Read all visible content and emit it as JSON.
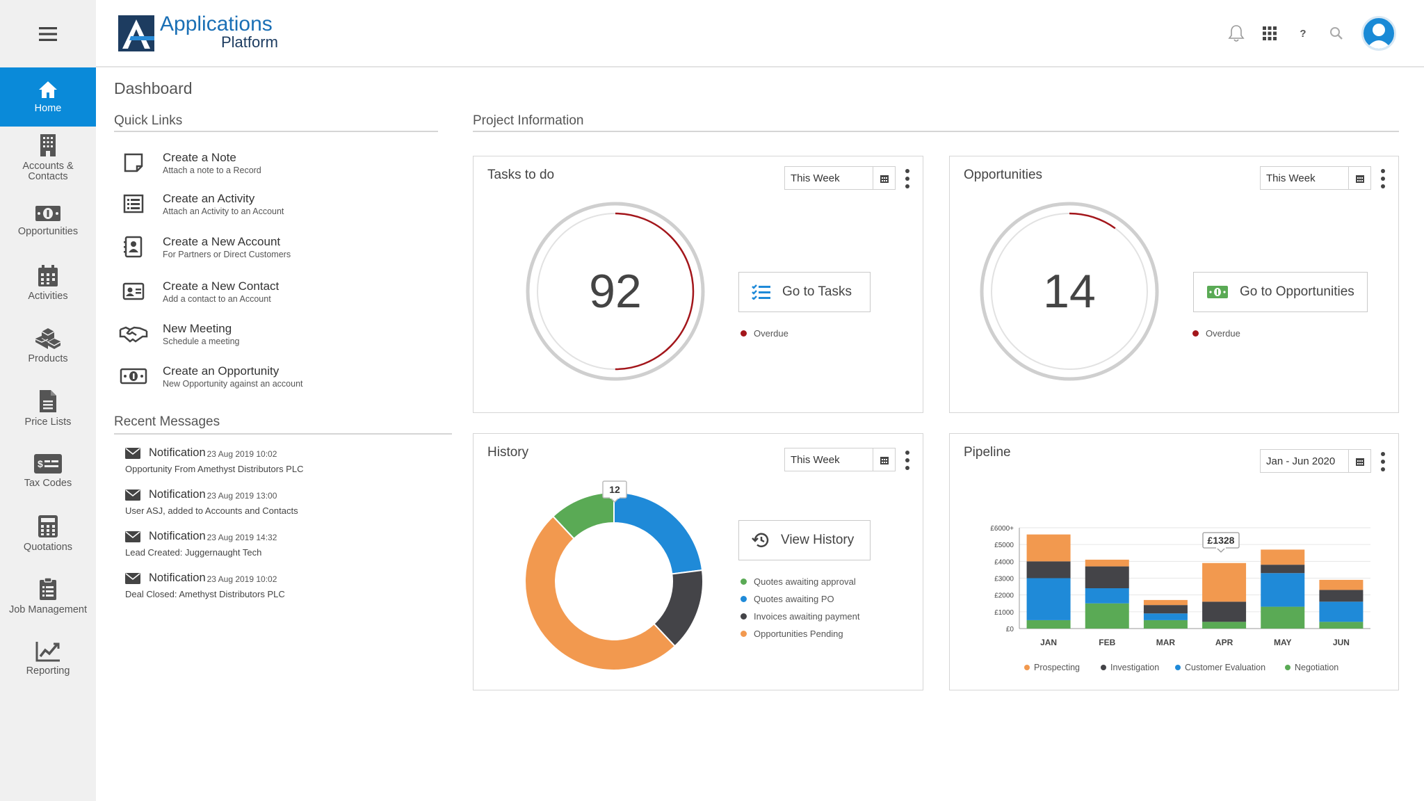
{
  "app": {
    "title_line1": "Applications",
    "title_line2": "Platform"
  },
  "topbar": {
    "help_label": "?"
  },
  "sidebar": {
    "items": [
      {
        "label": "Home",
        "icon": "home-icon",
        "active": true
      },
      {
        "label": "Accounts & Contacts",
        "icon": "building-icon"
      },
      {
        "label": "Opportunities",
        "icon": "money-icon"
      },
      {
        "label": "Activities",
        "icon": "calendar-icon"
      },
      {
        "label": "Products",
        "icon": "boxes-icon"
      },
      {
        "label": "Price Lists",
        "icon": "document-icon"
      },
      {
        "label": "Tax Codes",
        "icon": "tax-card-icon"
      },
      {
        "label": "Quotations",
        "icon": "calculator-icon"
      },
      {
        "label": "Job Management",
        "icon": "clipboard-icon"
      },
      {
        "label": "Reporting",
        "icon": "chart-line-icon"
      }
    ]
  },
  "page": {
    "title": "Dashboard"
  },
  "quick_links": {
    "title": "Quick Links",
    "items": [
      {
        "title": "Create a Note",
        "subtitle": "Attach a note to a Record",
        "icon": "note-icon"
      },
      {
        "title": "Create an Activity",
        "subtitle": "Attach an Activity to an Account",
        "icon": "list-icon"
      },
      {
        "title": "Create a New Account",
        "subtitle": "For Partners or Direct Customers",
        "icon": "address-book-icon"
      },
      {
        "title": "Create a New Contact",
        "subtitle": "Add a contact to an Account",
        "icon": "id-card-icon"
      },
      {
        "title": "New Meeting",
        "subtitle": "Schedule a meeting",
        "icon": "handshake-icon"
      },
      {
        "title": "Create an Opportunity",
        "subtitle": "New Opportunity against an account",
        "icon": "money-icon"
      }
    ]
  },
  "recent_messages": {
    "title": "Recent Messages",
    "items": [
      {
        "title": "Notification",
        "time": "23 Aug 2019 10:02",
        "body": "Opportunity From Amethyst Distributors PLC"
      },
      {
        "title": "Notification",
        "time": "23 Aug 2019 13:00",
        "body": "User ASJ, added to Accounts and Contacts"
      },
      {
        "title": "Notification",
        "time": "23 Aug 2019 14:32",
        "body": "Lead Created: Juggernaught Tech"
      },
      {
        "title": "Notification",
        "time": "23 Aug 2019 10:02",
        "body": "Deal Closed:  Amethyst Distributors PLC"
      }
    ]
  },
  "project_info": {
    "title": "Project Information"
  },
  "tasks": {
    "title": "Tasks to do",
    "period": "This Week",
    "count": "92",
    "overdue_fraction": 0.5,
    "button": "Go to Tasks",
    "legend": "Overdue"
  },
  "opportunities": {
    "title": "Opportunities",
    "period": "This Week",
    "count": "14",
    "overdue_fraction": 0.1,
    "button": "Go to Opportunities",
    "legend": "Overdue"
  },
  "history": {
    "title": "History",
    "period": "This Week",
    "button": "View History",
    "callout": "12",
    "legend": [
      "Quotes awaiting approval",
      "Quotes awaiting PO",
      "Invoices awaiting payment",
      "Opportunities Pending"
    ],
    "colors": [
      "#5aaa55",
      "#1f8ad8",
      "#444448",
      "#f2994f"
    ]
  },
  "pipeline": {
    "title": "Pipeline",
    "period": "Jan - Jun 2020",
    "callout": "£1328",
    "legend": [
      "Prospecting",
      "Investigation",
      "Customer Evaluation",
      "Negotiation"
    ],
    "colors": {
      "Prospecting": "#f2994f",
      "Investigation": "#444448",
      "Customer Evaluation": "#1f8ad8",
      "Negotiation": "#5aaa55"
    }
  },
  "chart_data": [
    {
      "type": "pie",
      "categories": [
        "Quotes awaiting approval",
        "Quotes awaiting PO",
        "Invoices awaiting payment",
        "Opportunities Pending"
      ],
      "values": [
        12,
        23,
        15,
        50
      ],
      "annotations": [
        "12"
      ]
    },
    {
      "type": "bar",
      "stacked": true,
      "categories": [
        "JAN",
        "FEB",
        "MAR",
        "APR",
        "MAY",
        "JUN"
      ],
      "y_ticks": [
        "£0",
        "£1000",
        "£2000",
        "£3000",
        "£4000",
        "£5000",
        "£6000+"
      ],
      "ylim": [
        0,
        6000
      ],
      "grid": true,
      "legend_position": "bottom",
      "series": [
        {
          "name": "Negotiation",
          "values": [
            500,
            1500,
            500,
            400,
            1300,
            400
          ]
        },
        {
          "name": "Customer Evaluation",
          "values": [
            2500,
            900,
            400,
            0,
            2000,
            1200
          ]
        },
        {
          "name": "Investigation",
          "values": [
            1000,
            1300,
            500,
            1200,
            500,
            700
          ]
        },
        {
          "name": "Prospecting",
          "values": [
            1600,
            400,
            300,
            2300,
            900,
            600
          ]
        }
      ],
      "annotations": [
        "£1328"
      ]
    }
  ]
}
